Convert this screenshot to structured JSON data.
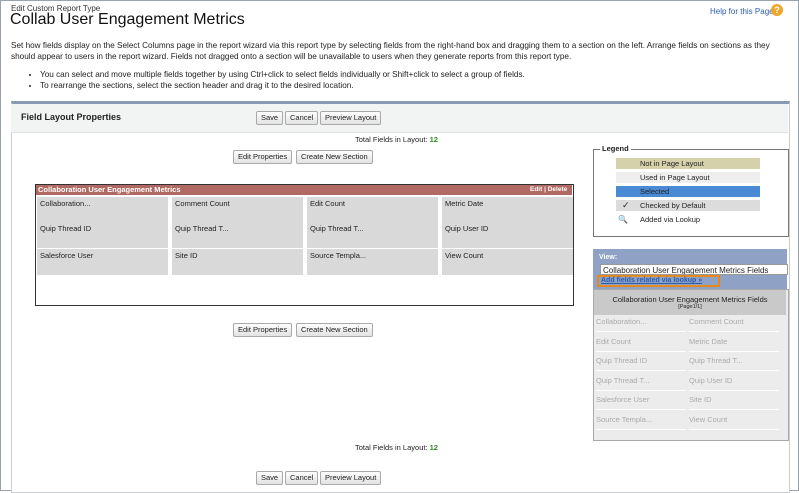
{
  "header": {
    "subtitle": "Edit Custom Report Type",
    "title": "Collab User Engagement Metrics",
    "help": "Help for this Page",
    "help_icon": "?"
  },
  "intro": "Set how fields display on the Select Columns page in the report wizard via this report type by selecting fields from the right-hand box and dragging them to a section on the left. Arrange fields on sections as they should appear to users in the report wizard. Fields not dragged onto a section will be unavailable to users when they generate reports from this report type.",
  "bullets": [
    "You can select and move multiple fields together by using Ctrl+click to select fields individually or Shift+click to select a group of fields.",
    "To rearrange the sections, select the section header and drag it to the desired location."
  ],
  "panel": {
    "title": "Field Layout Properties",
    "save": "Save",
    "cancel": "Cancel",
    "preview": "Preview Layout",
    "total_label": "Total Fields in Layout:",
    "total_value": "12",
    "edit_properties": "Edit Properties",
    "create_section": "Create New Section"
  },
  "section": {
    "title": "Collaboration User Engagement Metrics",
    "edit": "Edit",
    "sep": "|",
    "delete": "Delete",
    "fields": [
      "Collaboration...",
      "Comment Count",
      "Edit Count",
      "Metric Date",
      "Quip Thread ID",
      "Quip Thread T...",
      "Quip Thread T...",
      "Quip User ID",
      "Salesforce User",
      "Site ID",
      "Source Templa...",
      "View Count"
    ]
  },
  "legend": {
    "title": "Legend",
    "items": [
      {
        "label": "Not in Page Layout",
        "color": "#d5d2ab"
      },
      {
        "label": "Used in Page Layout",
        "color": "#eeeeee"
      },
      {
        "label": "Selected",
        "color": "#4a89d4"
      },
      {
        "label": "Checked by Default",
        "icon": "checkmark-icon",
        "glyph": "✓",
        "color": "#dcdcdc"
      },
      {
        "label": "Added via Lookup",
        "icon": "magnifier-icon",
        "glyph": "🔍",
        "color": "#ffffff"
      }
    ]
  },
  "view": {
    "label": "View:",
    "selected": "Collaboration User Engagement Metrics Fields",
    "lookup_link": "Add fields related via lookup »"
  },
  "available": {
    "title": "Collaboration User Engagement Metrics Fields",
    "page": "[Page1/1]",
    "fields": [
      "Collaboration...",
      "Comment Count",
      "Edit Count",
      "Metric Date",
      "Quip Thread ID",
      "Quip Thread T...",
      "Quip Thread T...",
      "Quip User ID",
      "Salesforce User",
      "Site ID",
      "Source Templa...",
      "View Count"
    ]
  }
}
